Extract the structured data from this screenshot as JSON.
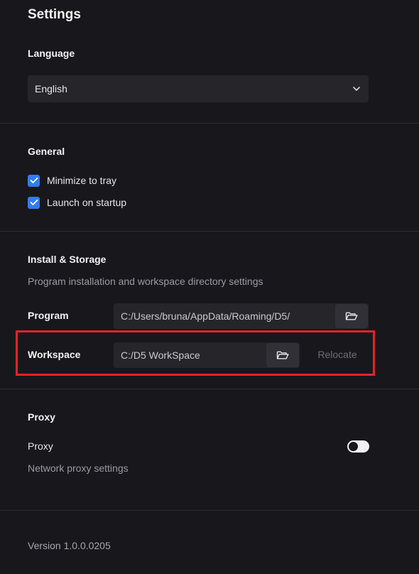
{
  "page": {
    "title": "Settings"
  },
  "language": {
    "section_title": "Language",
    "selected": "English"
  },
  "general": {
    "section_title": "General",
    "options": [
      {
        "label": "Minimize to tray",
        "checked": true
      },
      {
        "label": "Launch on startup",
        "checked": true
      }
    ]
  },
  "install_storage": {
    "section_title": "Install & Storage",
    "description": "Program installation and workspace directory settings",
    "program_label": "Program",
    "program_path": "C:/Users/bruna/AppData/Roaming/D5/",
    "workspace_label": "Workspace",
    "workspace_path": "C:/D5 WorkSpace",
    "relocate_label": "Relocate"
  },
  "proxy": {
    "section_title": "Proxy",
    "label": "Proxy",
    "description": "Network proxy settings",
    "enabled": false
  },
  "footer": {
    "version": "Version 1.0.0.0205"
  },
  "icons": {
    "dropdown": "chevron-down-icon",
    "checkbox": "check-icon",
    "folder": "folder-open-icon"
  },
  "colors": {
    "background": "#18181c",
    "accent": "#2f7cf6",
    "highlight": "#e3242b"
  }
}
